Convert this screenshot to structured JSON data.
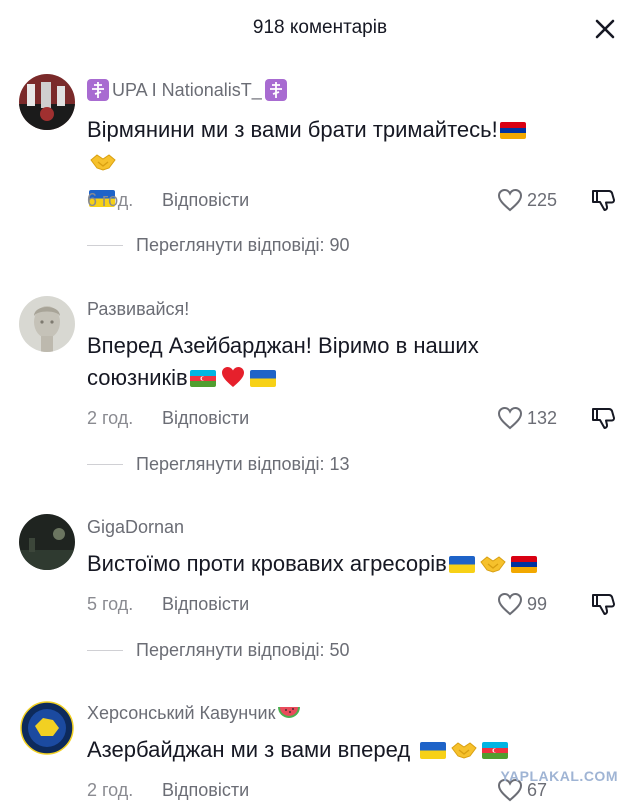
{
  "header": {
    "title": "918 коментарів"
  },
  "comments": [
    {
      "username": "UPA I NationalisT_",
      "text": "Вірмянини ми з вами брати тримайтесь!",
      "time": "6 год.",
      "reply_label": "Відповісти",
      "likes": "225",
      "view_replies": "Переглянути відповіді: 90"
    },
    {
      "username": "Развивайся!",
      "text_line1": "Вперед Азейбарджан! Віримо в наших",
      "text_line2": "союзників",
      "time": "2 год.",
      "reply_label": "Відповісти",
      "likes": "132",
      "view_replies": "Переглянути відповіді: 13"
    },
    {
      "username": "GigaDornan",
      "text": "Вистоїмо проти кровавих агресорів",
      "time": "5 год.",
      "reply_label": "Відповісти",
      "likes": "99",
      "view_replies": "Переглянути відповіді: 50"
    },
    {
      "username": "Херсонський Кавунчик",
      "text": "Азербайджан ми з вами вперед",
      "time": "2 год.",
      "reply_label": "Відповісти",
      "likes": "67"
    }
  ],
  "watermark": "YAPLAKAL.COM",
  "icons": {
    "close": "close-icon",
    "like": "heart-outline-icon",
    "dislike": "thumbs-down-icon"
  },
  "colors": {
    "text_primary": "#161823",
    "text_secondary": "#6b6d75",
    "divider": "#d0d0d4"
  }
}
